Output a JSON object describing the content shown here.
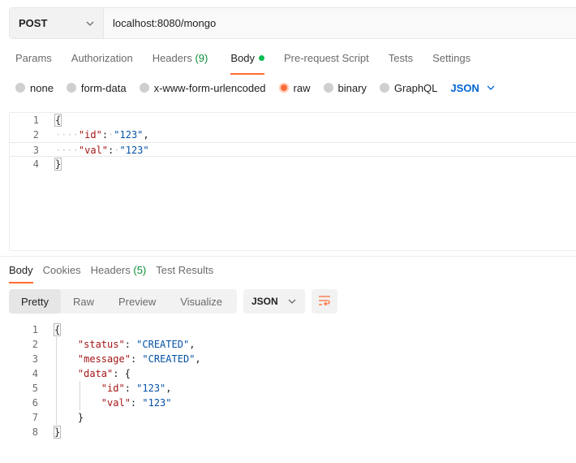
{
  "request": {
    "method": "POST",
    "url": "localhost:8080/mongo"
  },
  "request_tabs": [
    {
      "label": "Params"
    },
    {
      "label": "Authorization"
    },
    {
      "label": "Headers",
      "count": "(9)"
    },
    {
      "label": "Body"
    },
    {
      "label": "Pre-request Script"
    },
    {
      "label": "Tests"
    },
    {
      "label": "Settings"
    }
  ],
  "body_types": {
    "none": "none",
    "form_data": "form-data",
    "urlencoded": "x-www-form-urlencoded",
    "raw": "raw",
    "binary": "binary",
    "graphql": "GraphQL",
    "format": "JSON",
    "selected": "raw"
  },
  "request_body": {
    "line_numbers": [
      "1",
      "2",
      "3",
      "4"
    ],
    "lines": [
      {
        "open": "{"
      },
      {
        "key": "\"id\"",
        "value": "\"123\"",
        "suffix": ","
      },
      {
        "key": "\"val\"",
        "value": "\"123\""
      },
      {
        "close": "}"
      }
    ]
  },
  "response_tabs": [
    {
      "label": "Body"
    },
    {
      "label": "Cookies"
    },
    {
      "label": "Headers",
      "count": "(5)"
    },
    {
      "label": "Test Results"
    }
  ],
  "response_view": {
    "modes": [
      "Pretty",
      "Raw",
      "Preview",
      "Visualize"
    ],
    "active_mode": "Pretty",
    "format": "JSON"
  },
  "response_body": {
    "line_numbers": [
      "1",
      "2",
      "3",
      "4",
      "5",
      "6",
      "7",
      "8"
    ],
    "status_key": "\"status\"",
    "status_value": "\"CREATED\"",
    "message_key": "\"message\"",
    "message_value": "\"CREATED\"",
    "data_key": "\"data\"",
    "id_key": "\"id\"",
    "id_value": "\"123\"",
    "val_key": "\"val\"",
    "val_value": "\"123\""
  },
  "colors": {
    "accent": "#ff6c37",
    "link_blue": "#0265d2",
    "status_green": "#0cbb52"
  }
}
